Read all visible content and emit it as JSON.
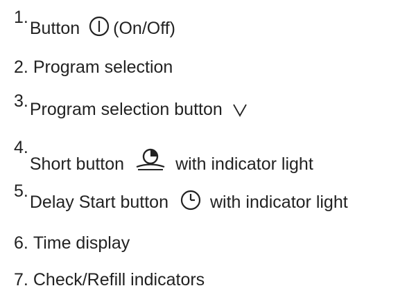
{
  "items": [
    {
      "num": "1.",
      "before": "Button",
      "icon": "power-icon",
      "after": "(On/Off)"
    },
    {
      "num": "2.",
      "text": "Program selection"
    },
    {
      "num": "3.",
      "before": "Program selection button",
      "icon": "chevron-down-icon",
      "after": ""
    },
    {
      "num": "4.",
      "before": "Short button",
      "icon": "short-program-icon",
      "after": "with indicator light"
    },
    {
      "num": "5.",
      "before": "Delay Start button",
      "icon": "clock-icon",
      "after": "with indicator light"
    },
    {
      "num": "6.",
      "text": "Time display"
    },
    {
      "num": "7.",
      "text": "Check/Refill indicators"
    }
  ],
  "colors": {
    "text": "#222222",
    "background": "#ffffff"
  }
}
